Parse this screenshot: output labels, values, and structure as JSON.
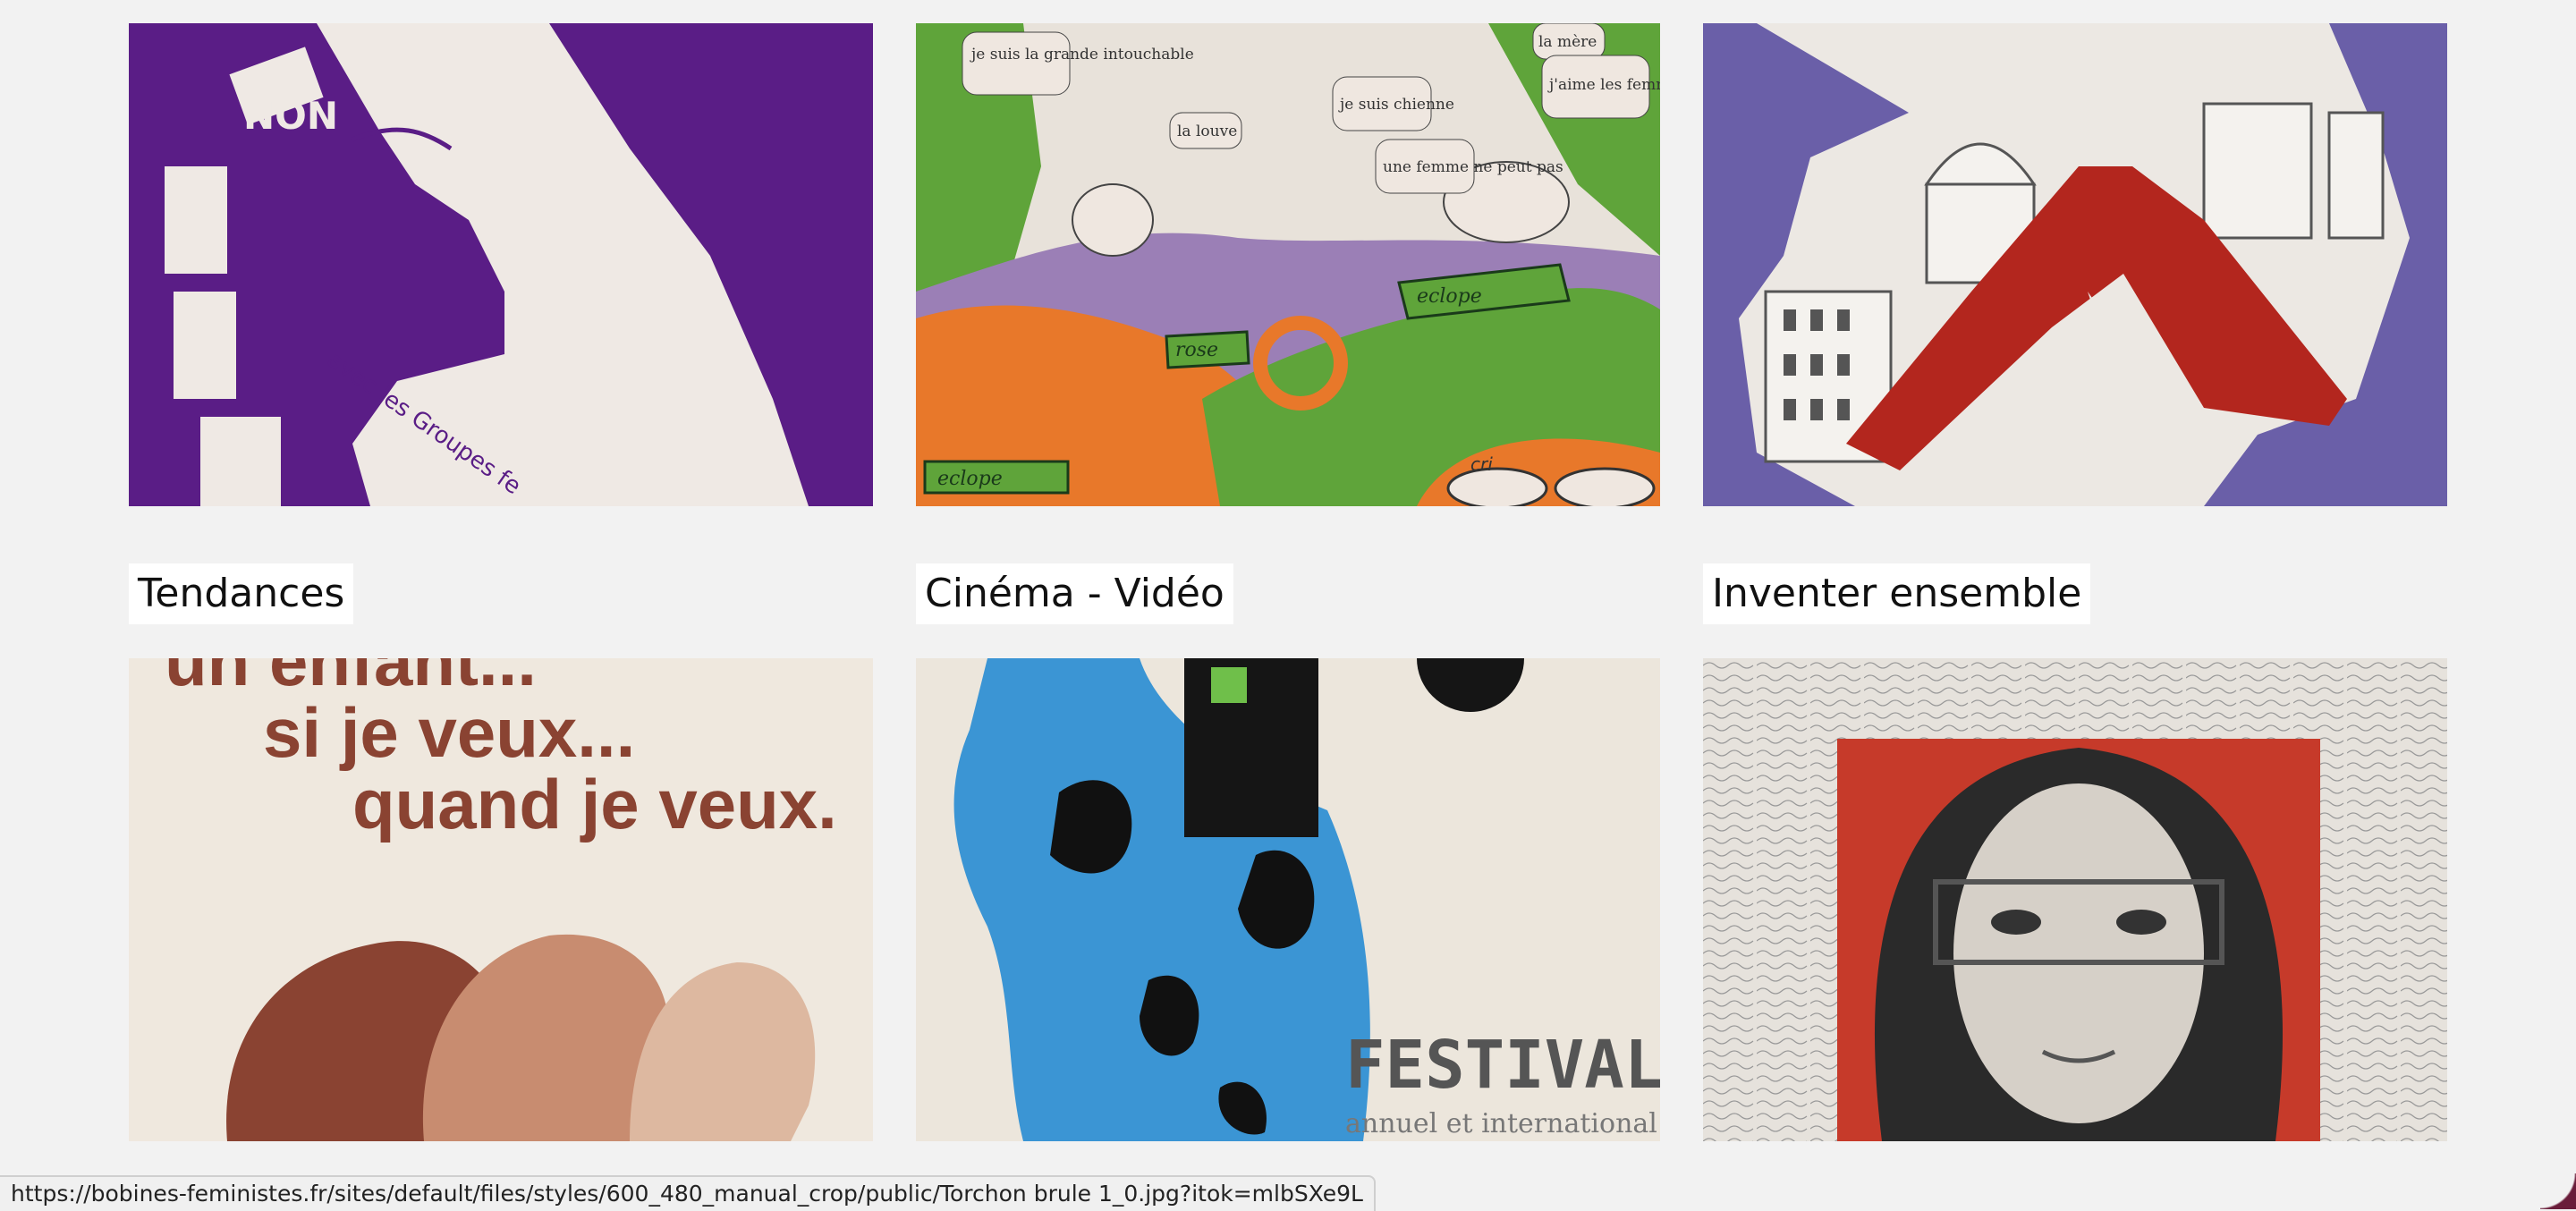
{
  "cards_top": [
    {
      "name": "poster-non-purple",
      "caption": "avec les Groupes fe",
      "sign": "NON"
    },
    {
      "name": "poster-psychedelic-landscape",
      "bubbles": [
        "je suis la grande intouchable",
        "la louve",
        "je suis chienne",
        "une femme ne peut pas",
        "la mère",
        "j'aime les femmes"
      ],
      "tags": [
        "eclope",
        "rose",
        "eclope"
      ],
      "cri": "cri"
    },
    {
      "name": "poster-crowd-map"
    }
  ],
  "sections": [
    {
      "title": "Tendances"
    },
    {
      "title": "Cinéma - Vidéo"
    },
    {
      "title": "Inventer ensemble"
    }
  ],
  "cards_bottom": [
    {
      "name": "poster-un-enfant",
      "lines": [
        "un enfant...",
        "si je veux...",
        "quand je veux."
      ]
    },
    {
      "name": "poster-festival",
      "title": "FESTIVAL",
      "subtitle": "annuel et international"
    },
    {
      "name": "poster-portrait-text"
    }
  ],
  "status_bar": {
    "url": "https://bobines-feministes.fr/sites/default/files/styles/600_480_manual_crop/public/Torchon brule 1_0.jpg?itok=mlbSXe9L"
  },
  "colors": {
    "page_bg": "#f2f2f2",
    "purple": "#5a1d86",
    "violet": "#6a5fa8",
    "brick": "#8a4332",
    "blue": "#3b95d4",
    "red": "#c63a2a"
  }
}
